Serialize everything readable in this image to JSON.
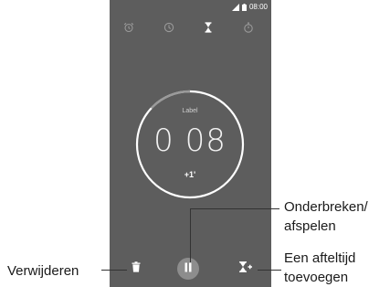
{
  "status_bar": {
    "time": "08:00",
    "icons": [
      "signal-icon",
      "battery-icon"
    ]
  },
  "tabs": [
    {
      "name": "alarm",
      "icon": "alarm-clock-icon",
      "active": false
    },
    {
      "name": "clock",
      "icon": "clock-icon",
      "active": false
    },
    {
      "name": "timer",
      "icon": "hourglass-icon",
      "active": true
    },
    {
      "name": "stopwatch",
      "icon": "stopwatch-icon",
      "active": false
    }
  ],
  "timer": {
    "label": "Label",
    "time": "0 08",
    "add_minute": "+1'",
    "progress": 0.13
  },
  "controls": {
    "delete_icon": "trash-icon",
    "pause_icon": "pause-icon",
    "add_timer_icon": "add-timer-icon"
  },
  "callouts": {
    "pause_play": [
      "Onderbreken/",
      "afspelen"
    ],
    "delete": "Verwijderen",
    "add_timer": [
      "Een afteltijd",
      "toevoegen"
    ]
  },
  "colors": {
    "screen_bg": "#5d5d5d",
    "ring": "#ffffff",
    "ring_progress": "#9a9a9a",
    "pause_button_bg": "#8d8d8d",
    "text_light": "#f2f2f2"
  }
}
